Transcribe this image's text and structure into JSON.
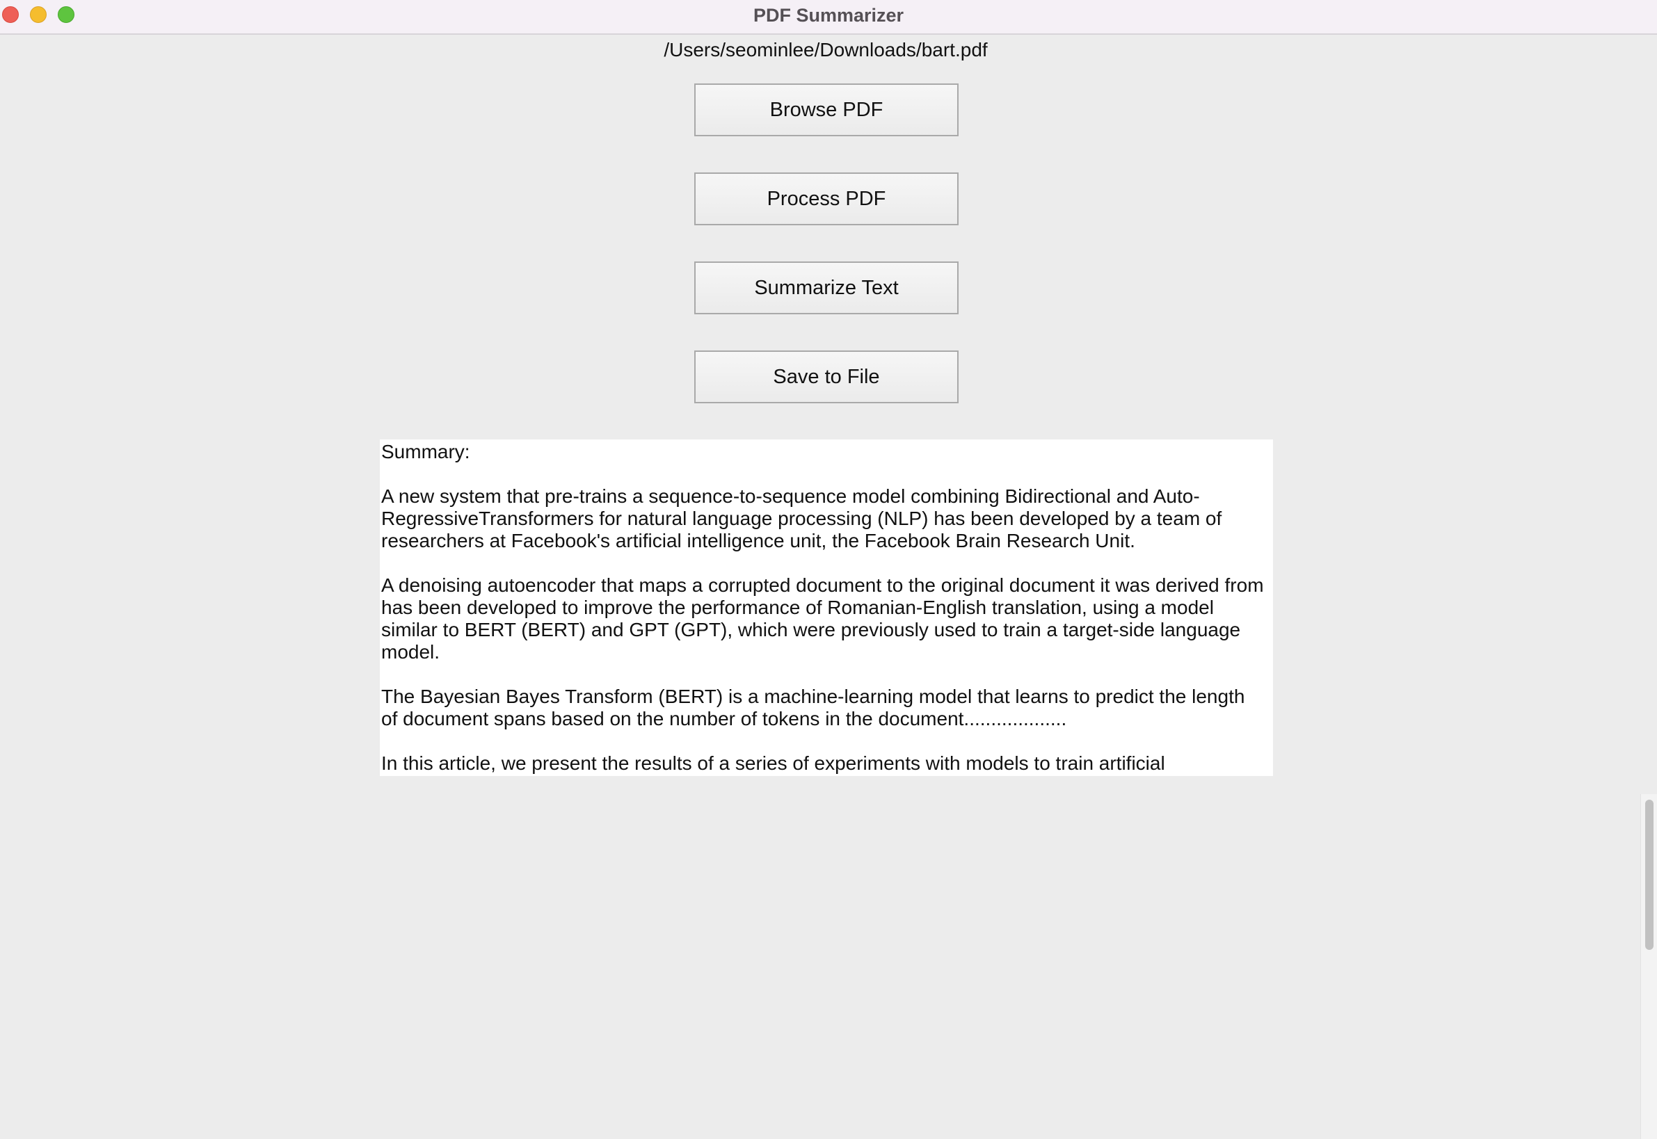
{
  "window": {
    "title": "PDF Summarizer"
  },
  "file_path": "/Users/seominlee/Downloads/bart.pdf",
  "buttons": {
    "browse": "Browse PDF",
    "process": "Process PDF",
    "summarize": "Summarize Text",
    "save": "Save to File"
  },
  "summary": {
    "heading": "Summary:",
    "paragraphs": [
      "A new system that pre-trains a sequence-to-sequence model combining Bidirectional and Auto-RegressiveTransformers for natural language processing (NLP) has been developed by a team of researchers at Facebook's artificial intelligence unit, the Facebook Brain Research Unit.",
      "A denoising autoencoder that maps a corrupted document to the original document it was derived from has been developed to improve the performance of Romanian-English translation, using a model similar to BERT (BERT) and GPT (GPT), which were previously used to train a target-side language model.",
      "The Bayesian Bayes Transform (BERT) is a machine-learning model that learns to predict the length of document spans based on the number of tokens in the document...................",
      "In this article, we present the results of a series of experiments with models to train artificial"
    ]
  },
  "colors": {
    "window_bg": "#ececec",
    "titlebar_bg": "#f5f0f6",
    "close": "#ee5f57",
    "minimize": "#f5bd2e",
    "maximize": "#5ec43f",
    "text_area_bg": "#ffffff"
  }
}
